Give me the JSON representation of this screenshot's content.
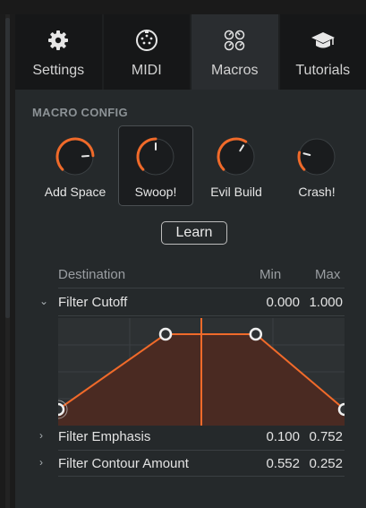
{
  "tabs": [
    {
      "label": "Settings",
      "icon": "gear-icon",
      "active": false
    },
    {
      "label": "MIDI",
      "icon": "midi-port-icon",
      "active": false
    },
    {
      "label": "Macros",
      "icon": "macros-knobs-icon",
      "active": true
    },
    {
      "label": "Tutorials",
      "icon": "graduation-cap-icon",
      "active": false
    }
  ],
  "macro_config": {
    "title": "MACRO CONFIG",
    "macros": [
      {
        "label": "Add Space",
        "value": 0.82,
        "selected": false
      },
      {
        "label": "Swoop!",
        "value": 0.5,
        "selected": true
      },
      {
        "label": "Evil Build",
        "value": 0.62,
        "selected": false
      },
      {
        "label": "Crash!",
        "value": 0.22,
        "selected": false
      }
    ],
    "learn_label": "Learn"
  },
  "table": {
    "headers": {
      "destination": "Destination",
      "min": "Min",
      "max": "Max"
    },
    "rows": [
      {
        "name": "Filter Cutoff",
        "min": "0.000",
        "max": "1.000",
        "expanded": true
      },
      {
        "name": "Filter Emphasis",
        "min": "0.100",
        "max": "0.752",
        "expanded": false
      },
      {
        "name": "Filter Contour Amount",
        "min": "0.552",
        "max": "0.252",
        "expanded": false
      }
    ]
  },
  "curve": {
    "points": [
      [
        0,
        0.15
      ],
      [
        0.375,
        0.85
      ],
      [
        0.69,
        0.85
      ],
      [
        1,
        0.15
      ]
    ],
    "playhead": 0.5
  },
  "colors": {
    "accent": "#f06a2a",
    "curve_fill": "#4a2a22",
    "background": "#25292b"
  }
}
